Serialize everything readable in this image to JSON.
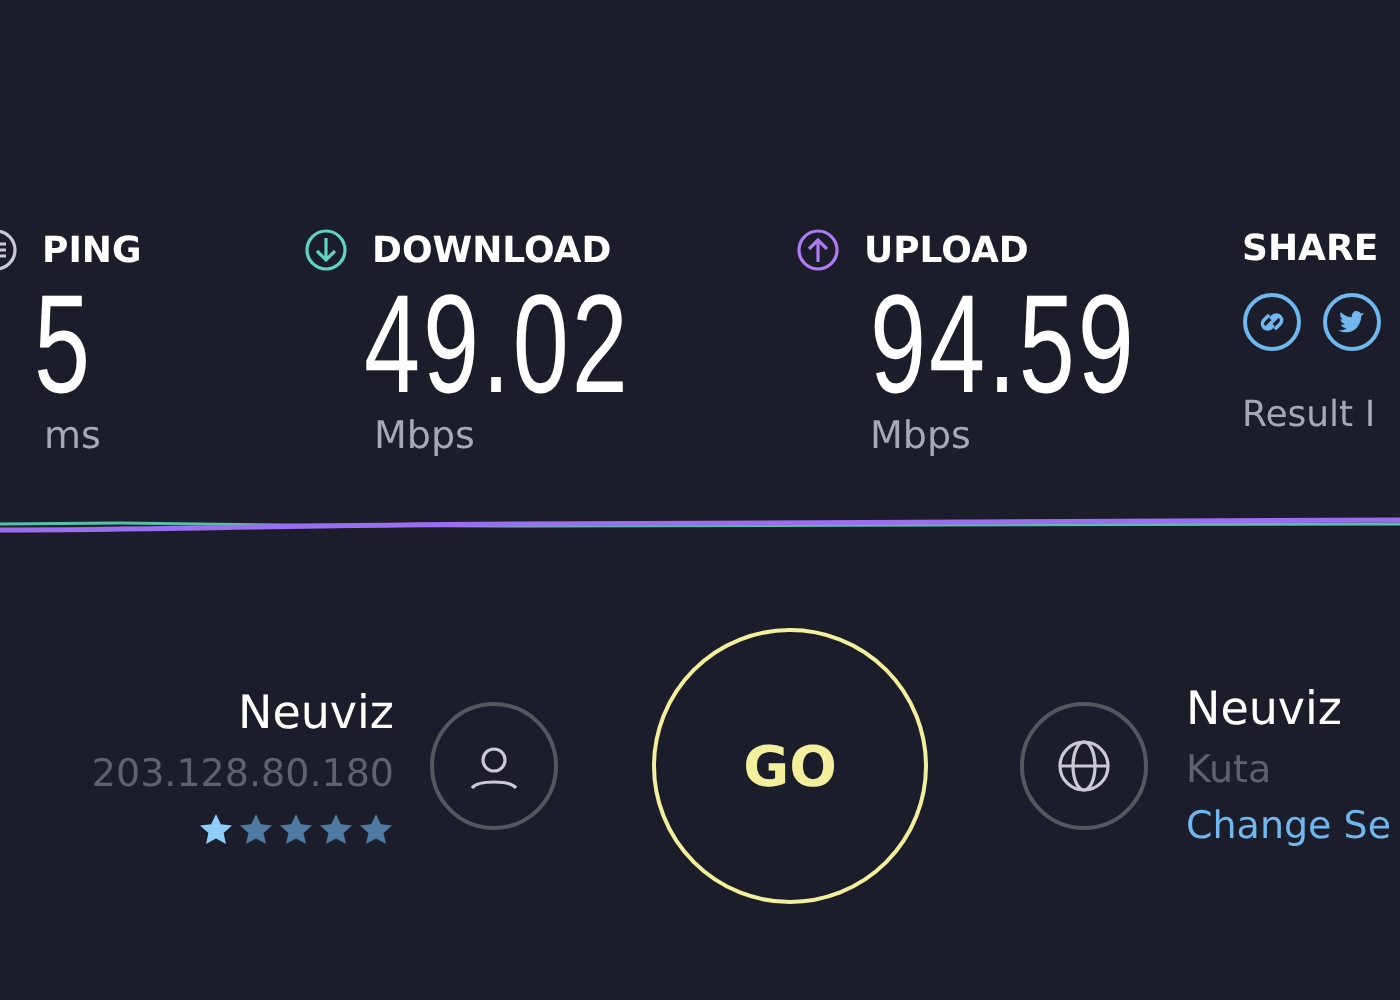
{
  "metrics": [
    {
      "kind": "ping",
      "label": "PING",
      "value": "5",
      "unit": "ms"
    },
    {
      "kind": "download",
      "label": "DOWNLOAD",
      "value": "49.02",
      "unit": "Mbps"
    },
    {
      "kind": "upload",
      "label": "UPLOAD",
      "value": "94.59",
      "unit": "Mbps"
    }
  ],
  "share": {
    "label": "SHARE",
    "result_label": "Result I"
  },
  "go_button": {
    "label": "GO"
  },
  "provider": {
    "name": "Neuviz",
    "ip": "203.128.80.180",
    "stars": 1
  },
  "server": {
    "name": "Neuviz",
    "location": "Kuta",
    "change_link": "Change Se"
  }
}
